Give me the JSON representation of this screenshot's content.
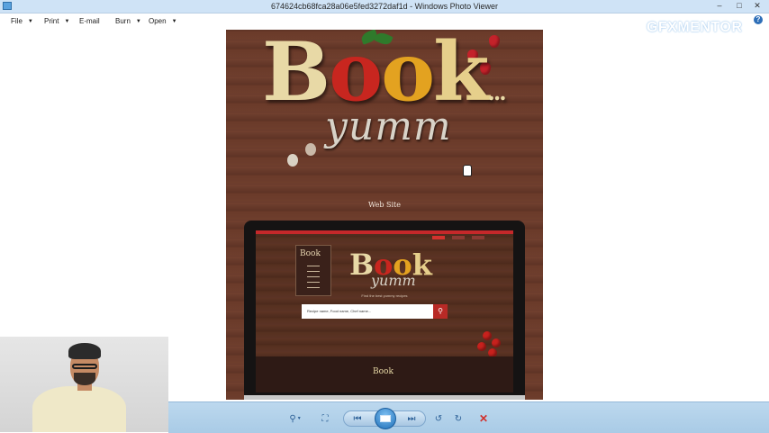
{
  "window": {
    "title": "674624cb68fca28a06e5fed3272daf1d - Windows Photo Viewer",
    "min_glyph": "–",
    "max_glyph": "□",
    "close_glyph": "✕"
  },
  "menu": {
    "file": "File",
    "print": "Print",
    "email": "E-mail",
    "burn": "Burn",
    "open": "Open",
    "help_glyph": "?"
  },
  "watermark": "GFXMENTOR",
  "image": {
    "brand_letters": [
      "B",
      "o",
      "o",
      "k"
    ],
    "brand_dots": "...",
    "script_word": "yumm",
    "section_label": "Web Site",
    "mockup": {
      "menu_card_title": "Book",
      "tagline": "Find the best yummy recipes",
      "search_placeholder": "Recipe name, Food name, Chef name...",
      "footer_logo": "Book"
    }
  },
  "toolbar": {
    "zoom_glyph": "⚲",
    "actual_size_glyph": "⛶",
    "prev_glyph": "⏮",
    "next_glyph": "⏭",
    "rotate_ccw_glyph": "↺",
    "rotate_cw_glyph": "↻",
    "delete_glyph": "✕"
  },
  "colors": {
    "titlebar": "#cfe3f6",
    "toolbar": "#a9cbe6",
    "accent_red": "#c5282a",
    "wood": "#6e3e2d"
  }
}
